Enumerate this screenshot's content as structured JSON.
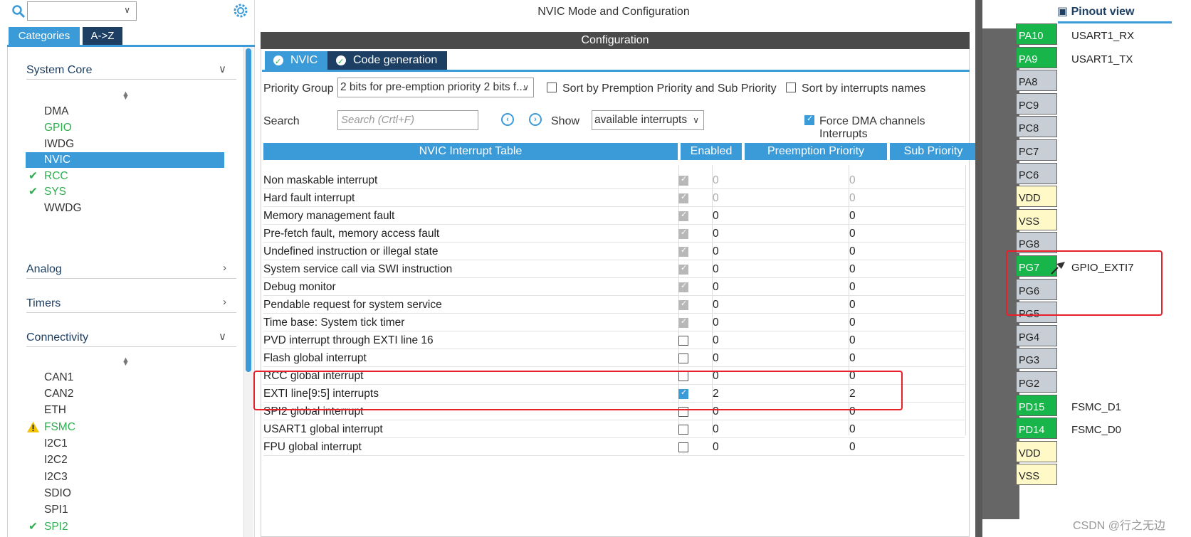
{
  "left": {
    "tabs": [
      "Categories",
      "A->Z"
    ],
    "system_core": {
      "title": "System Core",
      "items": [
        {
          "label": "DMA",
          "state": "none"
        },
        {
          "label": "GPIO",
          "state": "green"
        },
        {
          "label": "IWDG",
          "state": "none"
        },
        {
          "label": "NVIC",
          "state": "selected"
        },
        {
          "label": "RCC",
          "state": "checked"
        },
        {
          "label": "SYS",
          "state": "checked"
        },
        {
          "label": "WWDG",
          "state": "none"
        }
      ]
    },
    "analog": {
      "title": "Analog"
    },
    "timers": {
      "title": "Timers"
    },
    "connectivity": {
      "title": "Connectivity",
      "items": [
        {
          "label": "CAN1",
          "state": "none"
        },
        {
          "label": "CAN2",
          "state": "none"
        },
        {
          "label": "ETH",
          "state": "none"
        },
        {
          "label": "FSMC",
          "state": "warning"
        },
        {
          "label": "I2C1",
          "state": "none"
        },
        {
          "label": "I2C2",
          "state": "none"
        },
        {
          "label": "I2C3",
          "state": "none"
        },
        {
          "label": "SDIO",
          "state": "none"
        },
        {
          "label": "SPI1",
          "state": "none"
        },
        {
          "label": "SPI2",
          "state": "checked"
        }
      ]
    }
  },
  "middle": {
    "title": "NVIC Mode and Configuration",
    "config_bar": "Configuration",
    "tabs": [
      "NVIC",
      "Code generation"
    ],
    "priority_group_label": "Priority Group",
    "priority_group_value": "2 bits for pre-emption priority 2 bits f...",
    "sort_premption_label": "Sort by Premption Priority and Sub Priority",
    "sort_names_label": "Sort by interrupts names",
    "search_label": "Search",
    "search_placeholder": "Search (Crtl+F)",
    "show_label": "Show",
    "show_value": "available interrupts",
    "force_dma_label": "Force DMA channels Interrupts",
    "table_headers": [
      "NVIC Interrupt Table",
      "Enabled",
      "Preemption Priority",
      "Sub Priority"
    ],
    "rows": [
      {
        "name": "Non maskable interrupt",
        "enabled": "locked",
        "pre": "0",
        "sub": "0",
        "dim": true
      },
      {
        "name": "Hard fault interrupt",
        "enabled": "locked",
        "pre": "0",
        "sub": "0",
        "dim": true
      },
      {
        "name": "Memory management fault",
        "enabled": "locked",
        "pre": "0",
        "sub": "0",
        "dim": false
      },
      {
        "name": "Pre-fetch fault, memory access fault",
        "enabled": "locked",
        "pre": "0",
        "sub": "0",
        "dim": false
      },
      {
        "name": "Undefined instruction or illegal state",
        "enabled": "locked",
        "pre": "0",
        "sub": "0",
        "dim": false
      },
      {
        "name": "System service call via SWI instruction",
        "enabled": "locked",
        "pre": "0",
        "sub": "0",
        "dim": false
      },
      {
        "name": "Debug monitor",
        "enabled": "locked",
        "pre": "0",
        "sub": "0",
        "dim": false
      },
      {
        "name": "Pendable request for system service",
        "enabled": "locked",
        "pre": "0",
        "sub": "0",
        "dim": false
      },
      {
        "name": "Time base: System tick timer",
        "enabled": "locked",
        "pre": "0",
        "sub": "0",
        "dim": false
      },
      {
        "name": "PVD interrupt through EXTI line 16",
        "enabled": "off",
        "pre": "0",
        "sub": "0",
        "dim": false
      },
      {
        "name": "Flash global interrupt",
        "enabled": "off",
        "pre": "0",
        "sub": "0",
        "dim": false
      },
      {
        "name": "RCC global interrupt",
        "enabled": "off",
        "pre": "0",
        "sub": "0",
        "dim": false
      },
      {
        "name": "EXTI line[9:5] interrupts",
        "enabled": "on",
        "pre": "2",
        "sub": "2",
        "dim": false
      },
      {
        "name": "SPI2 global interrupt",
        "enabled": "off",
        "pre": "0",
        "sub": "0",
        "dim": false
      },
      {
        "name": "USART1 global interrupt",
        "enabled": "off",
        "pre": "0",
        "sub": "0",
        "dim": false
      },
      {
        "name": "FPU global interrupt",
        "enabled": "off",
        "pre": "0",
        "sub": "0",
        "dim": false
      }
    ]
  },
  "right": {
    "pinout_view": "Pinout view",
    "pins": [
      {
        "pin": "PA10",
        "color": "green",
        "label": "USART1_RX"
      },
      {
        "pin": "PA9",
        "color": "green",
        "label": "USART1_TX"
      },
      {
        "pin": "PA8",
        "color": "grey",
        "label": ""
      },
      {
        "pin": "PC9",
        "color": "grey",
        "label": ""
      },
      {
        "pin": "PC8",
        "color": "grey",
        "label": ""
      },
      {
        "pin": "PC7",
        "color": "grey",
        "label": ""
      },
      {
        "pin": "PC6",
        "color": "grey",
        "label": ""
      },
      {
        "pin": "VDD",
        "color": "yellow",
        "label": ""
      },
      {
        "pin": "VSS",
        "color": "yellow",
        "label": ""
      },
      {
        "pin": "PG8",
        "color": "grey",
        "label": ""
      },
      {
        "pin": "PG7",
        "color": "green",
        "label": "GPIO_EXTI7"
      },
      {
        "pin": "PG6",
        "color": "grey",
        "label": ""
      },
      {
        "pin": "PG5",
        "color": "grey",
        "label": ""
      },
      {
        "pin": "PG4",
        "color": "grey",
        "label": ""
      },
      {
        "pin": "PG3",
        "color": "grey",
        "label": ""
      },
      {
        "pin": "PG2",
        "color": "grey",
        "label": ""
      },
      {
        "pin": "PD15",
        "color": "green",
        "label": "FSMC_D1"
      },
      {
        "pin": "PD14",
        "color": "green",
        "label": "FSMC_D0"
      },
      {
        "pin": "VDD",
        "color": "yellow",
        "label": ""
      },
      {
        "pin": "VSS",
        "color": "yellow",
        "label": ""
      }
    ]
  },
  "watermark": "CSDN @行之无边",
  "colors": {
    "accent": "#3b9bd9",
    "dark_tab": "#1c3f63",
    "ok_green": "#2fae50",
    "pin_green": "#18b54a",
    "highlight_red": "#e8202a"
  }
}
